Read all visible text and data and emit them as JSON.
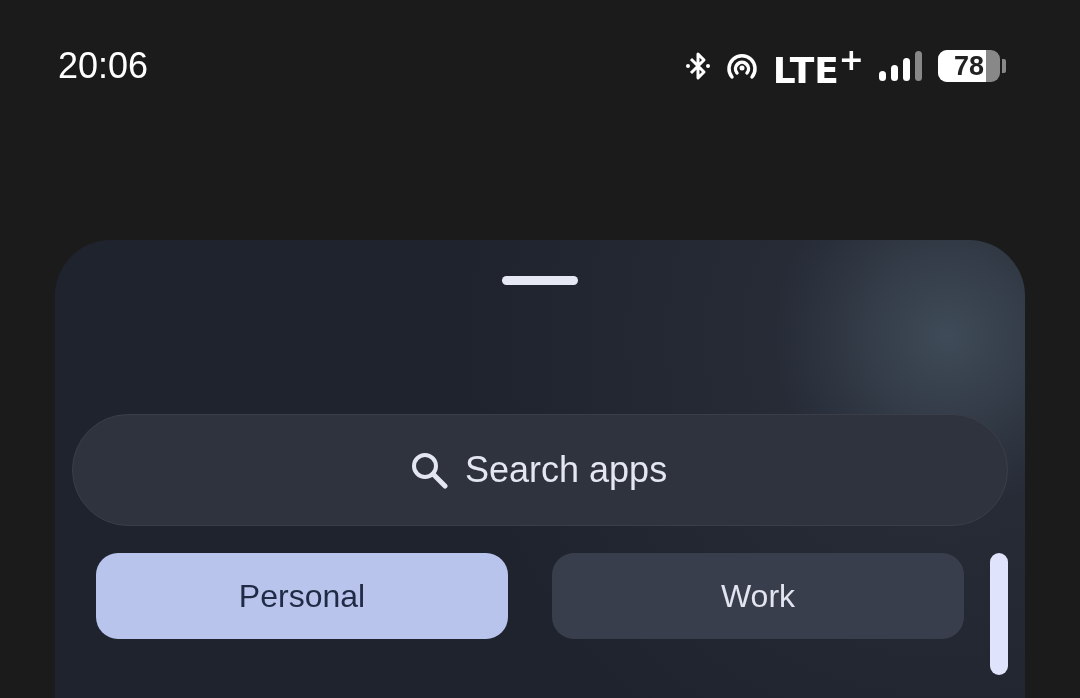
{
  "status_bar": {
    "time": "20:06",
    "network": "LTE$^{+}$",
    "battery": {
      "text": "78",
      "level": 0.78
    }
  },
  "search": {
    "placeholder": "Search apps"
  },
  "tabs": [
    {
      "label": "Personal",
      "selected": true
    },
    {
      "label": "Work",
      "selected": false
    }
  ]
}
